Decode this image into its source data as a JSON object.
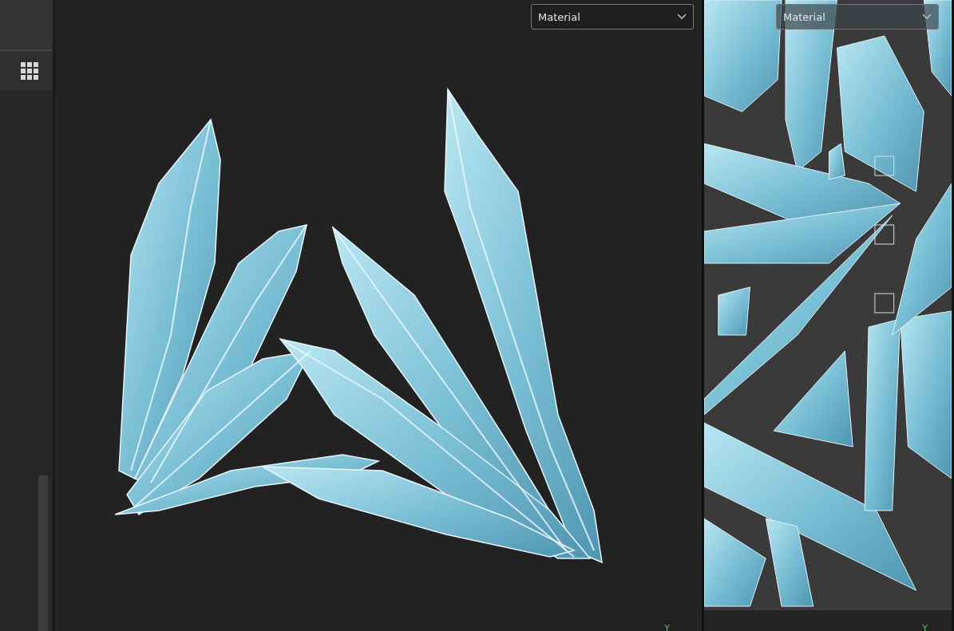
{
  "viewports": [
    {
      "kind": "model",
      "dropdown": "Material",
      "axis_label": "Y"
    },
    {
      "kind": "uv",
      "dropdown": "Material",
      "axis_label": "Y"
    }
  ]
}
